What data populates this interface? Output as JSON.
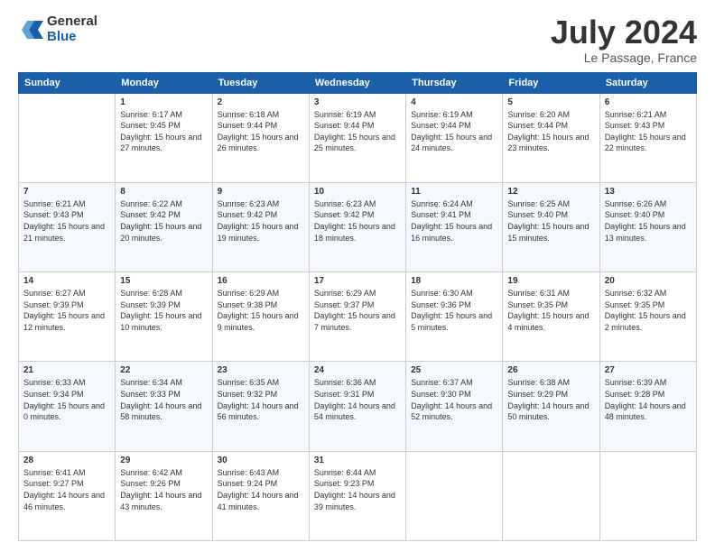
{
  "header": {
    "logo_general": "General",
    "logo_blue": "Blue",
    "month": "July 2024",
    "location": "Le Passage, France"
  },
  "weekdays": [
    "Sunday",
    "Monday",
    "Tuesday",
    "Wednesday",
    "Thursday",
    "Friday",
    "Saturday"
  ],
  "weeks": [
    [
      {
        "day": "",
        "sunrise": "",
        "sunset": "",
        "daylight": ""
      },
      {
        "day": "1",
        "sunrise": "Sunrise: 6:17 AM",
        "sunset": "Sunset: 9:45 PM",
        "daylight": "Daylight: 15 hours and 27 minutes."
      },
      {
        "day": "2",
        "sunrise": "Sunrise: 6:18 AM",
        "sunset": "Sunset: 9:44 PM",
        "daylight": "Daylight: 15 hours and 26 minutes."
      },
      {
        "day": "3",
        "sunrise": "Sunrise: 6:19 AM",
        "sunset": "Sunset: 9:44 PM",
        "daylight": "Daylight: 15 hours and 25 minutes."
      },
      {
        "day": "4",
        "sunrise": "Sunrise: 6:19 AM",
        "sunset": "Sunset: 9:44 PM",
        "daylight": "Daylight: 15 hours and 24 minutes."
      },
      {
        "day": "5",
        "sunrise": "Sunrise: 6:20 AM",
        "sunset": "Sunset: 9:44 PM",
        "daylight": "Daylight: 15 hours and 23 minutes."
      },
      {
        "day": "6",
        "sunrise": "Sunrise: 6:21 AM",
        "sunset": "Sunset: 9:43 PM",
        "daylight": "Daylight: 15 hours and 22 minutes."
      }
    ],
    [
      {
        "day": "7",
        "sunrise": "Sunrise: 6:21 AM",
        "sunset": "Sunset: 9:43 PM",
        "daylight": "Daylight: 15 hours and 21 minutes."
      },
      {
        "day": "8",
        "sunrise": "Sunrise: 6:22 AM",
        "sunset": "Sunset: 9:42 PM",
        "daylight": "Daylight: 15 hours and 20 minutes."
      },
      {
        "day": "9",
        "sunrise": "Sunrise: 6:23 AM",
        "sunset": "Sunset: 9:42 PM",
        "daylight": "Daylight: 15 hours and 19 minutes."
      },
      {
        "day": "10",
        "sunrise": "Sunrise: 6:23 AM",
        "sunset": "Sunset: 9:42 PM",
        "daylight": "Daylight: 15 hours and 18 minutes."
      },
      {
        "day": "11",
        "sunrise": "Sunrise: 6:24 AM",
        "sunset": "Sunset: 9:41 PM",
        "daylight": "Daylight: 15 hours and 16 minutes."
      },
      {
        "day": "12",
        "sunrise": "Sunrise: 6:25 AM",
        "sunset": "Sunset: 9:40 PM",
        "daylight": "Daylight: 15 hours and 15 minutes."
      },
      {
        "day": "13",
        "sunrise": "Sunrise: 6:26 AM",
        "sunset": "Sunset: 9:40 PM",
        "daylight": "Daylight: 15 hours and 13 minutes."
      }
    ],
    [
      {
        "day": "14",
        "sunrise": "Sunrise: 6:27 AM",
        "sunset": "Sunset: 9:39 PM",
        "daylight": "Daylight: 15 hours and 12 minutes."
      },
      {
        "day": "15",
        "sunrise": "Sunrise: 6:28 AM",
        "sunset": "Sunset: 9:39 PM",
        "daylight": "Daylight: 15 hours and 10 minutes."
      },
      {
        "day": "16",
        "sunrise": "Sunrise: 6:29 AM",
        "sunset": "Sunset: 9:38 PM",
        "daylight": "Daylight: 15 hours and 9 minutes."
      },
      {
        "day": "17",
        "sunrise": "Sunrise: 6:29 AM",
        "sunset": "Sunset: 9:37 PM",
        "daylight": "Daylight: 15 hours and 7 minutes."
      },
      {
        "day": "18",
        "sunrise": "Sunrise: 6:30 AM",
        "sunset": "Sunset: 9:36 PM",
        "daylight": "Daylight: 15 hours and 5 minutes."
      },
      {
        "day": "19",
        "sunrise": "Sunrise: 6:31 AM",
        "sunset": "Sunset: 9:35 PM",
        "daylight": "Daylight: 15 hours and 4 minutes."
      },
      {
        "day": "20",
        "sunrise": "Sunrise: 6:32 AM",
        "sunset": "Sunset: 9:35 PM",
        "daylight": "Daylight: 15 hours and 2 minutes."
      }
    ],
    [
      {
        "day": "21",
        "sunrise": "Sunrise: 6:33 AM",
        "sunset": "Sunset: 9:34 PM",
        "daylight": "Daylight: 15 hours and 0 minutes."
      },
      {
        "day": "22",
        "sunrise": "Sunrise: 6:34 AM",
        "sunset": "Sunset: 9:33 PM",
        "daylight": "Daylight: 14 hours and 58 minutes."
      },
      {
        "day": "23",
        "sunrise": "Sunrise: 6:35 AM",
        "sunset": "Sunset: 9:32 PM",
        "daylight": "Daylight: 14 hours and 56 minutes."
      },
      {
        "day": "24",
        "sunrise": "Sunrise: 6:36 AM",
        "sunset": "Sunset: 9:31 PM",
        "daylight": "Daylight: 14 hours and 54 minutes."
      },
      {
        "day": "25",
        "sunrise": "Sunrise: 6:37 AM",
        "sunset": "Sunset: 9:30 PM",
        "daylight": "Daylight: 14 hours and 52 minutes."
      },
      {
        "day": "26",
        "sunrise": "Sunrise: 6:38 AM",
        "sunset": "Sunset: 9:29 PM",
        "daylight": "Daylight: 14 hours and 50 minutes."
      },
      {
        "day": "27",
        "sunrise": "Sunrise: 6:39 AM",
        "sunset": "Sunset: 9:28 PM",
        "daylight": "Daylight: 14 hours and 48 minutes."
      }
    ],
    [
      {
        "day": "28",
        "sunrise": "Sunrise: 6:41 AM",
        "sunset": "Sunset: 9:27 PM",
        "daylight": "Daylight: 14 hours and 46 minutes."
      },
      {
        "day": "29",
        "sunrise": "Sunrise: 6:42 AM",
        "sunset": "Sunset: 9:26 PM",
        "daylight": "Daylight: 14 hours and 43 minutes."
      },
      {
        "day": "30",
        "sunrise": "Sunrise: 6:43 AM",
        "sunset": "Sunset: 9:24 PM",
        "daylight": "Daylight: 14 hours and 41 minutes."
      },
      {
        "day": "31",
        "sunrise": "Sunrise: 6:44 AM",
        "sunset": "Sunset: 9:23 PM",
        "daylight": "Daylight: 14 hours and 39 minutes."
      },
      {
        "day": "",
        "sunrise": "",
        "sunset": "",
        "daylight": ""
      },
      {
        "day": "",
        "sunrise": "",
        "sunset": "",
        "daylight": ""
      },
      {
        "day": "",
        "sunrise": "",
        "sunset": "",
        "daylight": ""
      }
    ]
  ]
}
